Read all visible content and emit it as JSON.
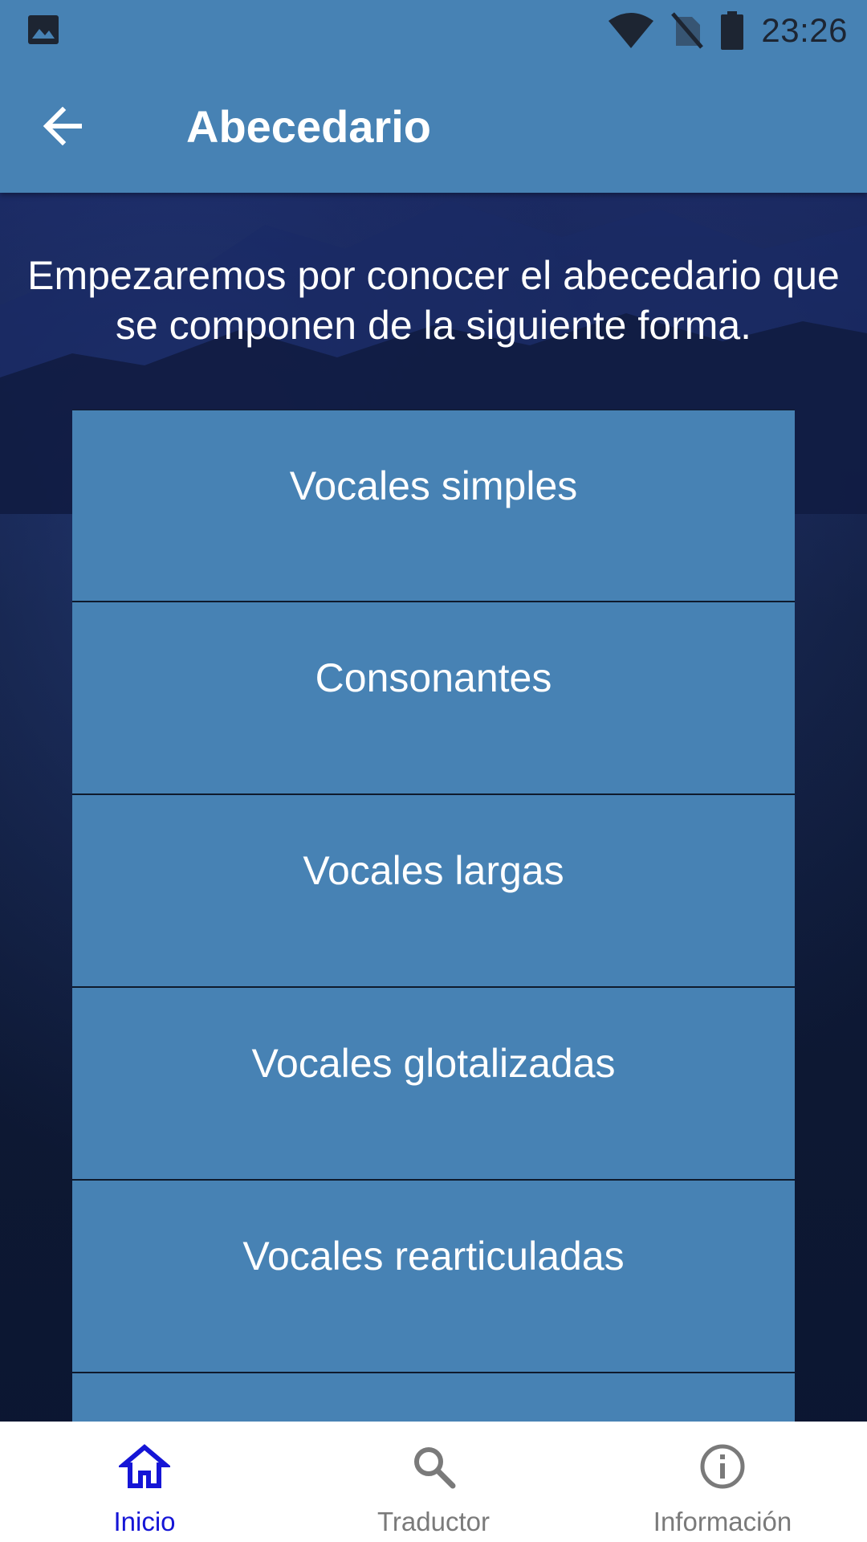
{
  "status_bar": {
    "time": "23:26",
    "icons": [
      "image-notification-icon",
      "wifi-icon",
      "no-sim-icon",
      "battery-icon"
    ]
  },
  "app_bar": {
    "title": "Abecedario",
    "back_icon": "arrow-back-icon"
  },
  "intro": {
    "line1": "Empezaremos por conocer el abecedario que",
    "line2": "se componen de la siguiente forma."
  },
  "categories": [
    {
      "label": "Vocales simples"
    },
    {
      "label": "Consonantes"
    },
    {
      "label": "Vocales largas"
    },
    {
      "label": "Vocales glotalizadas"
    },
    {
      "label": "Vocales rearticuladas"
    },
    {
      "label": ""
    }
  ],
  "bottom_nav": {
    "items": [
      {
        "label": "Inicio",
        "icon": "home-icon",
        "active": true
      },
      {
        "label": "Traductor",
        "icon": "search-icon",
        "active": false
      },
      {
        "label": "Información",
        "icon": "info-icon",
        "active": false
      }
    ]
  },
  "colors": {
    "primary": "#4782b4",
    "active_nav": "#1515d6",
    "inactive_nav": "#7a7a7a",
    "background_dark": "#0e1a38"
  }
}
